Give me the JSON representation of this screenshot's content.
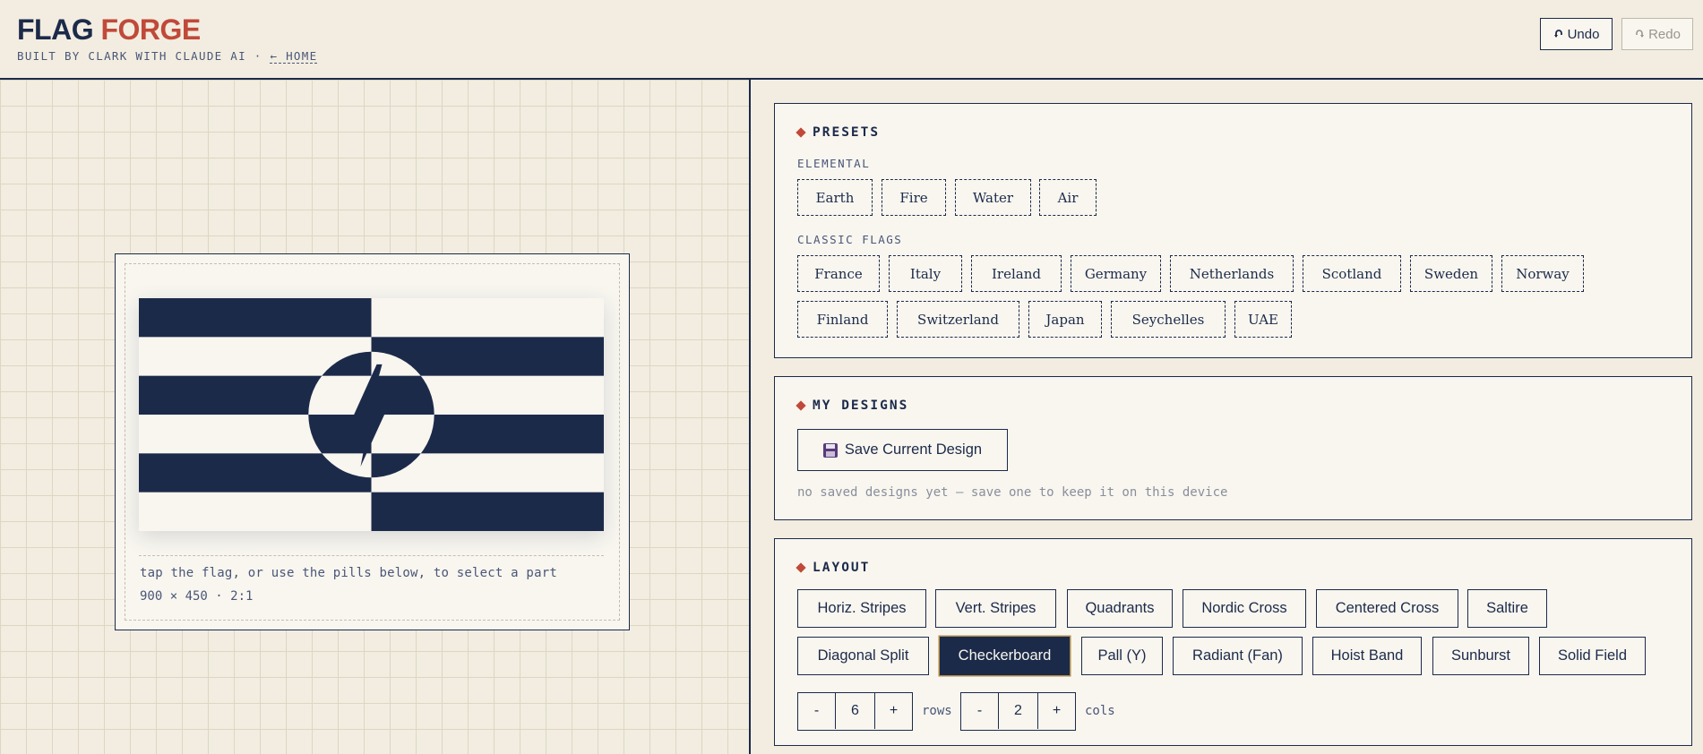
{
  "header": {
    "brand_part1": "FLAG",
    "brand_part2": "FORGE",
    "byline": "BUILT BY CLARK WITH CLAUDE AI ·",
    "home_link": "← HOME",
    "undo_label": "Undo",
    "redo_label": "Redo",
    "undo_icon": "undo-arrow-icon",
    "redo_icon": "redo-arrow-icon"
  },
  "canvas": {
    "hint": "tap the flag, or use the pills below, to select a part",
    "dimensions": "900 × 450 · 2:1",
    "flag": {
      "layout": "checkerboard",
      "rows": 6,
      "cols": 2,
      "color_a": "#1c2a4a",
      "color_b": "#f8f6ef",
      "emblem": "lightning-bolt-in-circle"
    }
  },
  "presets": {
    "title": "PRESETS",
    "elemental_label": "ELEMENTAL",
    "elemental": [
      "Earth",
      "Fire",
      "Water",
      "Air"
    ],
    "classic_label": "CLASSIC FLAGS",
    "classic": [
      "France",
      "Italy",
      "Ireland",
      "Germany",
      "Netherlands",
      "Scotland",
      "Sweden",
      "Norway",
      "Finland",
      "Switzerland",
      "Japan",
      "Seychelles",
      "UAE"
    ]
  },
  "my_designs": {
    "title": "MY DESIGNS",
    "save_label": "Save Current Design",
    "empty_note": "no saved designs yet — save one to keep it on this device"
  },
  "layout": {
    "title": "LAYOUT",
    "options": [
      "Horiz. Stripes",
      "Vert. Stripes",
      "Quadrants",
      "Nordic Cross",
      "Centered Cross",
      "Saltire",
      "Diagonal Split",
      "Checkerboard",
      "Pall (Y)",
      "Radiant (Fan)",
      "Hoist Band",
      "Sunburst",
      "Solid Field"
    ],
    "selected": "Checkerboard",
    "rows_value": "6",
    "rows_label": "rows",
    "cols_value": "2",
    "cols_label": "cols",
    "minus": "-",
    "plus": "+"
  },
  "colors": {
    "navy": "#1c2a4a",
    "accent_red": "#c0493a",
    "cream": "#f8f6ef",
    "background": "#f2ede0"
  }
}
